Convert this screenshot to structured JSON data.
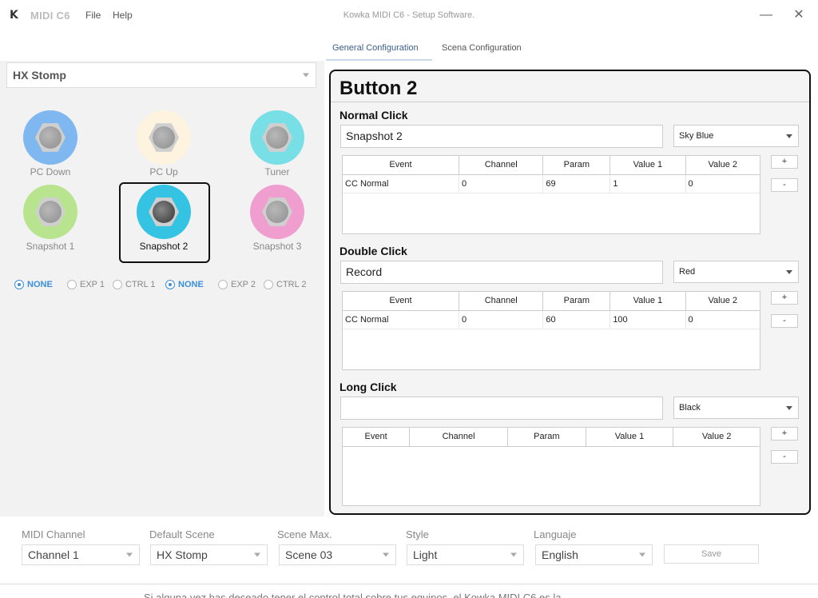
{
  "app": {
    "logo": "K",
    "name": "MIDI C6",
    "menu": [
      "File",
      "Help"
    ],
    "window_title": "Kowka MIDI C6 - Setup Software."
  },
  "window_controls": {
    "minimize": "—",
    "close": "✕"
  },
  "tabs": [
    {
      "label": "General Configuration",
      "active": true
    },
    {
      "label": "Scena Configuration",
      "active": false
    }
  ],
  "left": {
    "device": "HX Stomp",
    "pedals": [
      {
        "label": "PC Down",
        "color": "#7fb8f0"
      },
      {
        "label": "PC Up",
        "color": "#fdf3df"
      },
      {
        "label": "Tuner",
        "color": "#79dfe6"
      },
      {
        "label": "Snapshot 1",
        "color": "#b9e48f"
      },
      {
        "label": "Snapshot 2",
        "color": "#35c3e3",
        "selected": true
      },
      {
        "label": "Snapshot 3",
        "color": "#f09ed0"
      }
    ],
    "expression": [
      {
        "label": "NONE",
        "on": true
      },
      {
        "label": "EXP 1",
        "on": false
      },
      {
        "label": "CTRL 1",
        "on": false
      },
      {
        "label": "NONE",
        "on": true
      },
      {
        "label": "EXP 2",
        "on": false
      },
      {
        "label": "CTRL 2",
        "on": false
      }
    ]
  },
  "button": {
    "title": "Button 2",
    "columns": [
      "Event",
      "Channel",
      "Param",
      "Value 1",
      "Value 2"
    ],
    "add_label": "+",
    "remove_label": "-",
    "sections": [
      {
        "title": "Normal Click",
        "name": "Snapshot 2",
        "color": "Sky Blue",
        "rows": [
          [
            "CC Normal",
            "0",
            "69",
            "1",
            "0"
          ]
        ]
      },
      {
        "title": "Double Click",
        "name": "Record",
        "color": "Red",
        "rows": [
          [
            "CC Normal",
            "0",
            "60",
            "100",
            "0"
          ]
        ]
      },
      {
        "title": "Long Click",
        "name": "",
        "color": "Black",
        "rows": []
      }
    ]
  },
  "footer": {
    "midi_channel": {
      "label": "MIDI Channel",
      "value": "Channel 1"
    },
    "default_scene": {
      "label": "Default Scene",
      "value": "HX Stomp"
    },
    "scene_max": {
      "label": "Scene Max.",
      "value": "Scene 03"
    },
    "style": {
      "label": "Style",
      "value": "Light"
    },
    "language": {
      "label": "Languaje",
      "value": "English"
    },
    "save_label": "Save",
    "bottom_text": "Si alguna vez has deseado tener el control total sobre tus equipos, el Kowka MIDI C6 es la"
  }
}
